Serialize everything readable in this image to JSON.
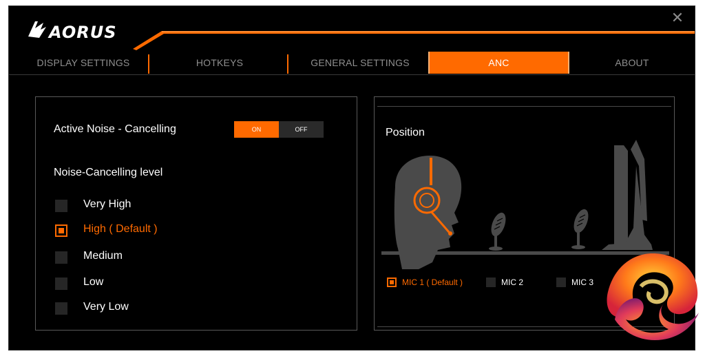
{
  "app": {
    "logo_text": "AORUS",
    "close_glyph": "✕"
  },
  "tabs": [
    {
      "label": "DISPLAY SETTINGS",
      "active": false
    },
    {
      "label": "HOTKEYS",
      "active": false
    },
    {
      "label": "GENERAL SETTINGS",
      "active": false
    },
    {
      "label": "ANC",
      "active": true
    },
    {
      "label": "ABOUT",
      "active": false
    }
  ],
  "anc": {
    "title": "Active Noise - Cancelling",
    "toggle": {
      "on_label": "ON",
      "off_label": "OFF",
      "value": "ON"
    },
    "level_heading": "Noise-Cancelling level",
    "levels": [
      {
        "label": "Very High",
        "selected": false
      },
      {
        "label": "High ( Default )",
        "selected": true
      },
      {
        "label": "Medium",
        "selected": false
      },
      {
        "label": "Low",
        "selected": false
      },
      {
        "label": "Very Low",
        "selected": false
      }
    ]
  },
  "position": {
    "heading": "Position",
    "mics": [
      {
        "label": "MIC 1 ( Default )",
        "selected": true
      },
      {
        "label": "MIC 2",
        "selected": false
      },
      {
        "label": "MIC 3",
        "selected": false
      }
    ]
  },
  "colors": {
    "accent": "#ff6a00",
    "background": "#000000",
    "inactive_text": "#8f8f8f",
    "illustration_gray": "#4a4a4a"
  },
  "icons": [
    "aorus-logo-icon",
    "close-icon",
    "headset-user-icon",
    "microphone-icon",
    "monitor-icon",
    "watermark-logo-icon"
  ]
}
